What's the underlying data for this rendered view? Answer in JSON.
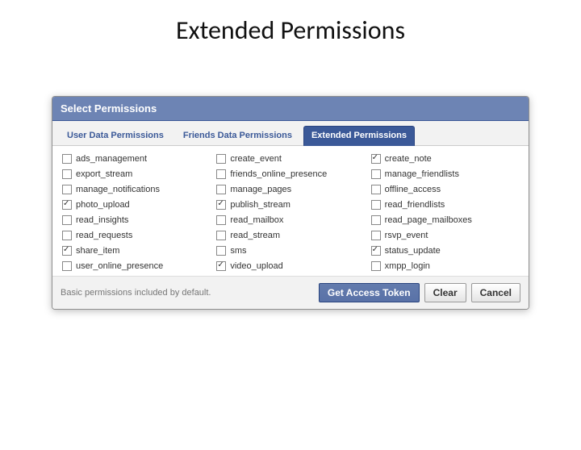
{
  "slide": {
    "title": "Extended Permissions"
  },
  "dialog": {
    "header": "Select Permissions",
    "footer_note": "Basic permissions included by default.",
    "buttons": {
      "primary": "Get Access Token",
      "clear": "Clear",
      "cancel": "Cancel"
    }
  },
  "tabs": [
    {
      "label": "User Data Permissions",
      "active": false
    },
    {
      "label": "Friends Data Permissions",
      "active": false
    },
    {
      "label": "Extended Permissions",
      "active": true
    }
  ],
  "permissions": [
    {
      "name": "ads_management",
      "checked": false
    },
    {
      "name": "create_event",
      "checked": false
    },
    {
      "name": "create_note",
      "checked": true
    },
    {
      "name": "export_stream",
      "checked": false
    },
    {
      "name": "friends_online_presence",
      "checked": false
    },
    {
      "name": "manage_friendlists",
      "checked": false
    },
    {
      "name": "manage_notifications",
      "checked": false
    },
    {
      "name": "manage_pages",
      "checked": false
    },
    {
      "name": "offline_access",
      "checked": false
    },
    {
      "name": "photo_upload",
      "checked": true
    },
    {
      "name": "publish_stream",
      "checked": true
    },
    {
      "name": "read_friendlists",
      "checked": false
    },
    {
      "name": "read_insights",
      "checked": false
    },
    {
      "name": "read_mailbox",
      "checked": false
    },
    {
      "name": "read_page_mailboxes",
      "checked": false
    },
    {
      "name": "read_requests",
      "checked": false
    },
    {
      "name": "read_stream",
      "checked": false
    },
    {
      "name": "rsvp_event",
      "checked": false
    },
    {
      "name": "share_item",
      "checked": true
    },
    {
      "name": "sms",
      "checked": false
    },
    {
      "name": "status_update",
      "checked": true
    },
    {
      "name": "user_online_presence",
      "checked": false
    },
    {
      "name": "video_upload",
      "checked": true
    },
    {
      "name": "xmpp_login",
      "checked": false
    }
  ]
}
